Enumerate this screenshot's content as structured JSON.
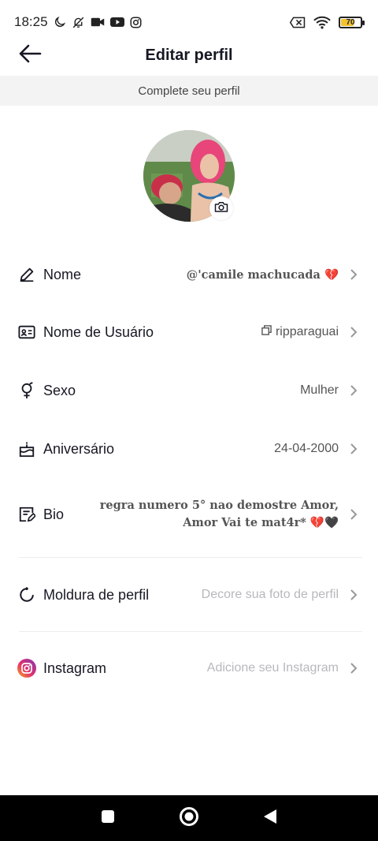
{
  "status_bar": {
    "time": "18:25",
    "battery": "70",
    "battery_level": 0.7,
    "left_icons": [
      "moon-icon",
      "bell-off-icon",
      "video-camera-icon",
      "youtube-icon",
      "instagram-icon"
    ],
    "right_icons": [
      "sim-off-icon",
      "wifi-icon",
      "battery-icon"
    ]
  },
  "header": {
    "title": "Editar perfil",
    "back_icon": "arrow-left-icon"
  },
  "banner": {
    "text": "Complete seu perfil"
  },
  "avatar": {
    "badge_icon": "camera-icon"
  },
  "fields": {
    "nome": {
      "label": "Nome",
      "value": "@'camile machucada 💔",
      "icon": "pencil-icon"
    },
    "username": {
      "label": "Nome de Usuário",
      "value": "ripparaguai",
      "icon": "id-card-icon",
      "value_icon": "copy-icon"
    },
    "sexo": {
      "label": "Sexo",
      "value": "Mulher",
      "icon": "gender-icon"
    },
    "aniversario": {
      "label": "Aniversário",
      "value": "24-04-2000",
      "icon": "cake-icon"
    },
    "bio": {
      "label": "Bio",
      "line1": "regra numero 5° nao demostre Amor,",
      "line2": "Amor Vai te mat4r* 💔🖤",
      "icon": "edit-note-icon"
    },
    "moldura": {
      "label": "Moldura de perfil",
      "placeholder": "Decore sua foto de perfil",
      "icon": "frame-icon"
    },
    "instagram": {
      "label": "Instagram",
      "placeholder": "Adicione seu Instagram",
      "icon": "instagram-logo-icon"
    }
  },
  "nav_bar": {
    "icons": [
      "recent-apps-icon",
      "home-icon",
      "back-icon"
    ]
  },
  "colors": {
    "banner_bg": "#f3f3f4",
    "placeholder": "#b8b8bc",
    "battery_fill": "#f2c230",
    "nav_bg": "#000000"
  }
}
